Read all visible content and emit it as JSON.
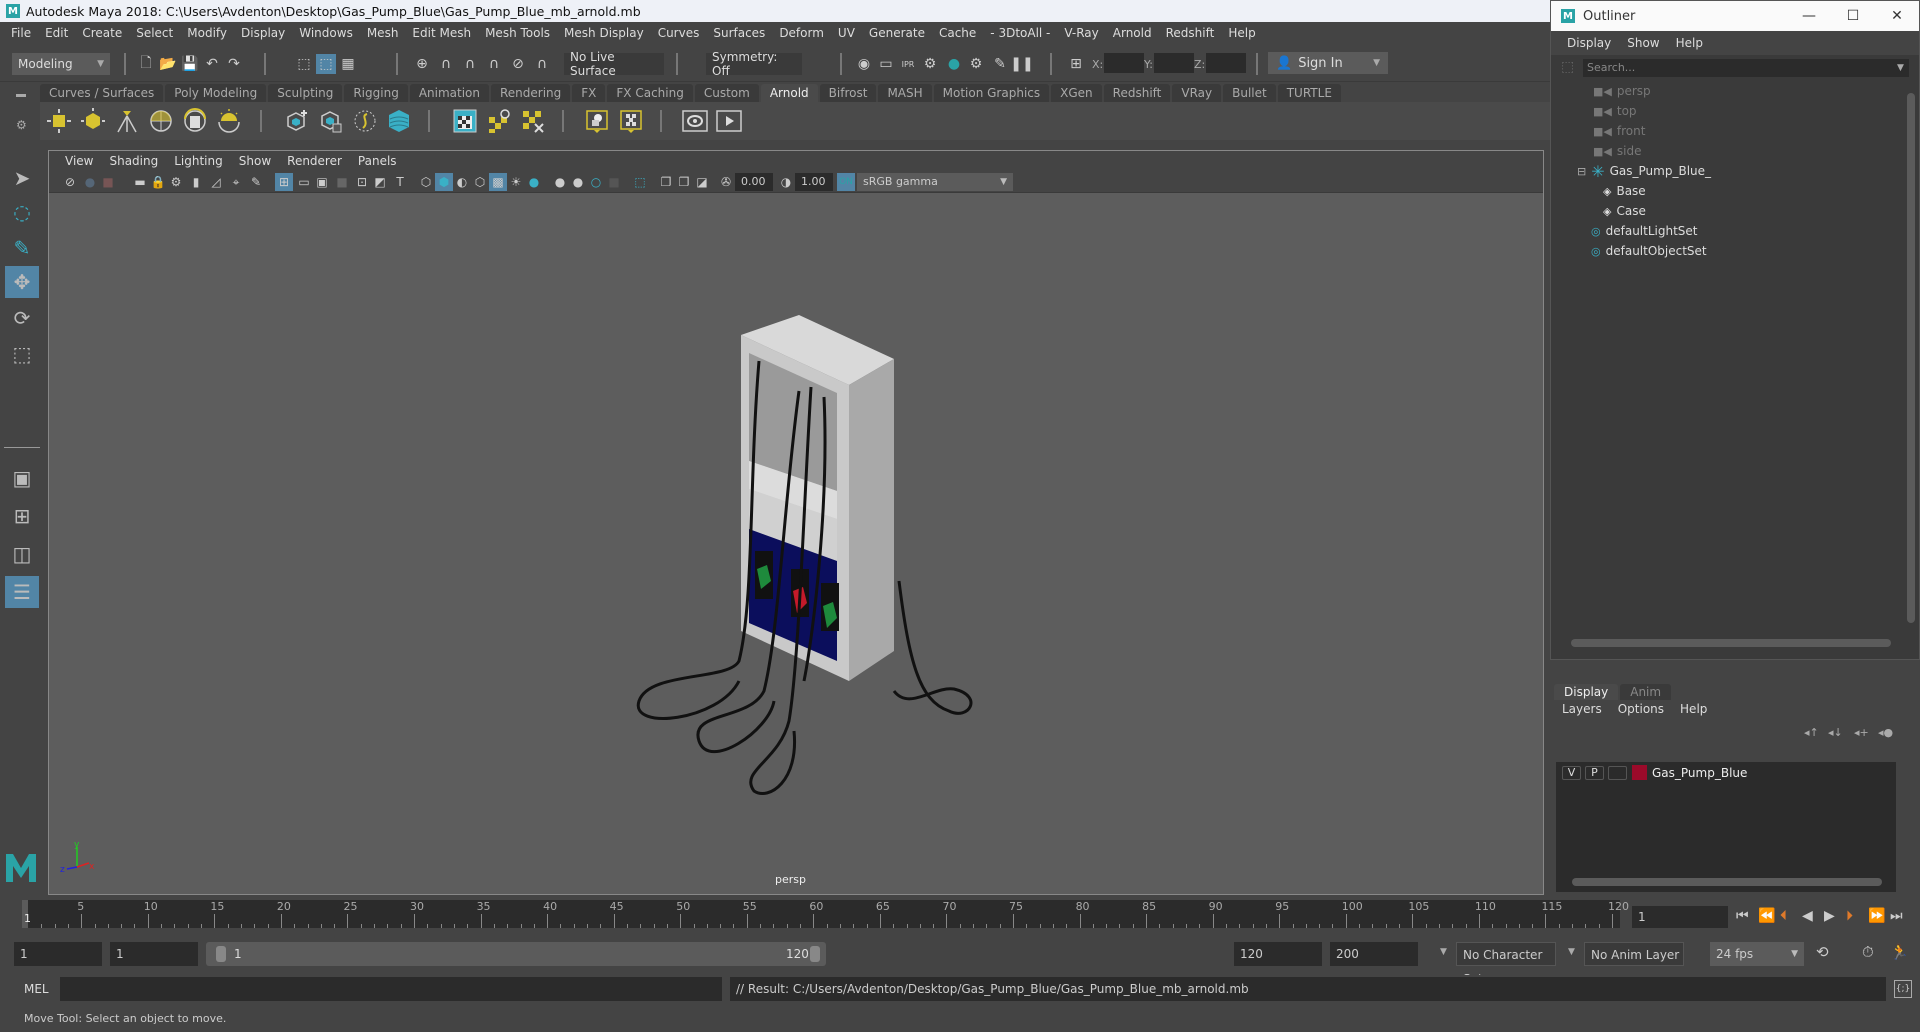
{
  "window": {
    "title": "Autodesk Maya 2018: C:\\Users\\Avdenton\\Desktop\\Gas_Pump_Blue\\Gas_Pump_Blue_mb_arnold.mb",
    "logo": "M"
  },
  "menu": [
    "File",
    "Edit",
    "Create",
    "Select",
    "Modify",
    "Display",
    "Windows",
    "Mesh",
    "Edit Mesh",
    "Mesh Tools",
    "Mesh Display",
    "Curves",
    "Surfaces",
    "Deform",
    "UV",
    "Generate",
    "Cache",
    "- 3DtoAll -",
    "V-Ray",
    "Arnold",
    "Redshift",
    "Help"
  ],
  "status_line": {
    "mode": "Modeling",
    "live_surface": "No Live Surface",
    "symmetry": "Symmetry: Off",
    "x_label": "X:",
    "y_label": "Y:",
    "z_label": "Z:",
    "sign_in": "Sign In"
  },
  "shelf": {
    "tabs": [
      "Curves / Surfaces",
      "Poly Modeling",
      "Sculpting",
      "Rigging",
      "Animation",
      "Rendering",
      "FX",
      "FX Caching",
      "Custom",
      "Arnold",
      "Bifrost",
      "MASH",
      "Motion Graphics",
      "XGen",
      "Redshift",
      "VRay",
      "Bullet",
      "TURTLE"
    ],
    "active_tab": "Arnold"
  },
  "viewport": {
    "menu": [
      "View",
      "Shading",
      "Lighting",
      "Show",
      "Renderer",
      "Panels"
    ],
    "exposure": "0.00",
    "gamma": "1.00",
    "color_space": "sRGB gamma",
    "camera": "persp",
    "axis": {
      "x": "x",
      "y": "y",
      "z": "z"
    }
  },
  "outliner": {
    "title": "Outliner",
    "menu": [
      "Display",
      "Show",
      "Help"
    ],
    "search_placeholder": "Search...",
    "items": [
      {
        "label": "persp",
        "icon": "camera-icon",
        "dim": true
      },
      {
        "label": "top",
        "icon": "camera-icon",
        "dim": true
      },
      {
        "label": "front",
        "icon": "camera-icon",
        "dim": true
      },
      {
        "label": "side",
        "icon": "camera-icon",
        "dim": true
      },
      {
        "label": "Gas_Pump_Blue_",
        "icon": "group-icon",
        "dim": false
      },
      {
        "label": "Base",
        "icon": "mesh-icon",
        "dim": false
      },
      {
        "label": "Case",
        "icon": "mesh-icon",
        "dim": false
      },
      {
        "label": "defaultLightSet",
        "icon": "set-icon",
        "dim": false
      },
      {
        "label": "defaultObjectSet",
        "icon": "set-icon",
        "dim": false
      }
    ]
  },
  "layers": {
    "tabs": [
      "Display",
      "Anim"
    ],
    "menu": [
      "Layers",
      "Options",
      "Help"
    ],
    "rows": [
      {
        "v": "V",
        "p": "P",
        "name": "Gas_Pump_Blue",
        "color": "#9b0a2a"
      }
    ]
  },
  "timeline": {
    "ticks": [
      5,
      10,
      15,
      20,
      25,
      30,
      35,
      40,
      45,
      50,
      55,
      60,
      65,
      70,
      75,
      80,
      85,
      90,
      95,
      100,
      105,
      110,
      115,
      120
    ],
    "current_frame": "1",
    "current_frame_field": "1"
  },
  "range": {
    "start": "1",
    "playback_start": "1",
    "slider_start": "1",
    "slider_end": "120",
    "playback_end": "120",
    "end": "200",
    "character_set": "No Character Set",
    "anim_layer": "No Anim Layer",
    "fps": "24 fps"
  },
  "command": {
    "lang": "MEL",
    "result": "// Result: C:/Users/Avdenton/Desktop/Gas_Pump_Blue/Gas_Pump_Blue_mb_arnold.mb"
  },
  "help_line": "Move Tool: Select an object to move.",
  "colors": {
    "accent": "#5285a6",
    "teal": "#2aa3a6",
    "layer": "#9b0a2a",
    "playhead": "#e07a2a"
  }
}
